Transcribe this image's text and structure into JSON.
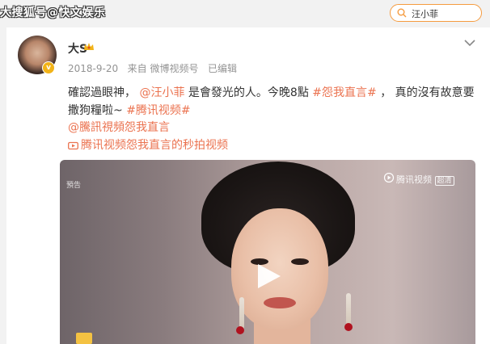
{
  "watermark": "大搜狐号@快文娱乐",
  "search": {
    "query": "汪小菲"
  },
  "post": {
    "author": "大S",
    "date": "2018-9-20",
    "from_prefix": "来自",
    "source": "微博视频号",
    "edited": "已编辑",
    "text_part1": "確認過眼神，",
    "mention": "@汪小菲",
    "text_part2": "是會發光的人。今晚8點",
    "hashtag1": "#怨我直言#",
    "text_part3": "，  真的沒有故意要撒狗糧啦~",
    "hashtag2": "#腾讯视频#",
    "mention_line": "@騰訊視頻怨我直言",
    "video_link": "腾讯视频怨我直言的秒拍视频"
  },
  "video": {
    "brand": "腾讯视频",
    "brand_tag": "超清",
    "corner_tag": "預告"
  },
  "colors": {
    "link": "#eb7350",
    "search_border": "#f59b3f",
    "vip": "#f2b318"
  }
}
